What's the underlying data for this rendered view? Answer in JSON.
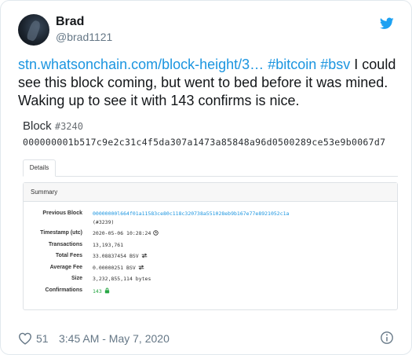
{
  "user": {
    "name": "Brad",
    "handle": "@brad1121"
  },
  "tweet": {
    "link": "stn.whatsonchain.com/block-height/3…",
    "hashtag1": "#bitcoin",
    "hashtag2": "#bsv",
    "text": "I could see this block coming, but went to bed before it was mined. Waking up to see it with 143 confirms is nice."
  },
  "embed": {
    "title": "Block",
    "number": "#3240",
    "hash": "000000001b517c9e2c31c4f5da307a1473a85848a96d0500289ce53e9b0067d7",
    "tab_details": "Details",
    "panel_title": "Summary",
    "rows": {
      "previous_block": {
        "label": "Previous Block",
        "value": "00000000l664f01a11583ce80c118c320738a551028eb9b167e77e8921052c1a",
        "sub": "(#3239)"
      },
      "timestamp": {
        "label": "Timestamp (utc)",
        "value": "2020-05-06 10:28:24"
      },
      "transactions": {
        "label": "Transactions",
        "value": "13,193,761"
      },
      "total_fees": {
        "label": "Total Fees",
        "value": "33.08837454 BSV"
      },
      "average_fee": {
        "label": "Average Fee",
        "value": "0.00000251 BSV"
      },
      "size": {
        "label": "Size",
        "value": "3,232,855,114 bytes"
      },
      "confirmations": {
        "label": "Confirmations",
        "value": "143"
      }
    }
  },
  "footer": {
    "likes": "51",
    "timestamp": "3:45 AM - May 7, 2020"
  },
  "colors": {
    "accent": "#1b95e0",
    "twitter_blue": "#1da1f2",
    "confirm_green": "#28a745",
    "muted": "#657786"
  },
  "icons": {
    "twitter": "twitter-bird-icon",
    "heart": "heart-icon",
    "info": "info-icon",
    "clock": "clock-icon",
    "exchange": "exchange-arrows-icon",
    "lock": "lock-icon"
  }
}
